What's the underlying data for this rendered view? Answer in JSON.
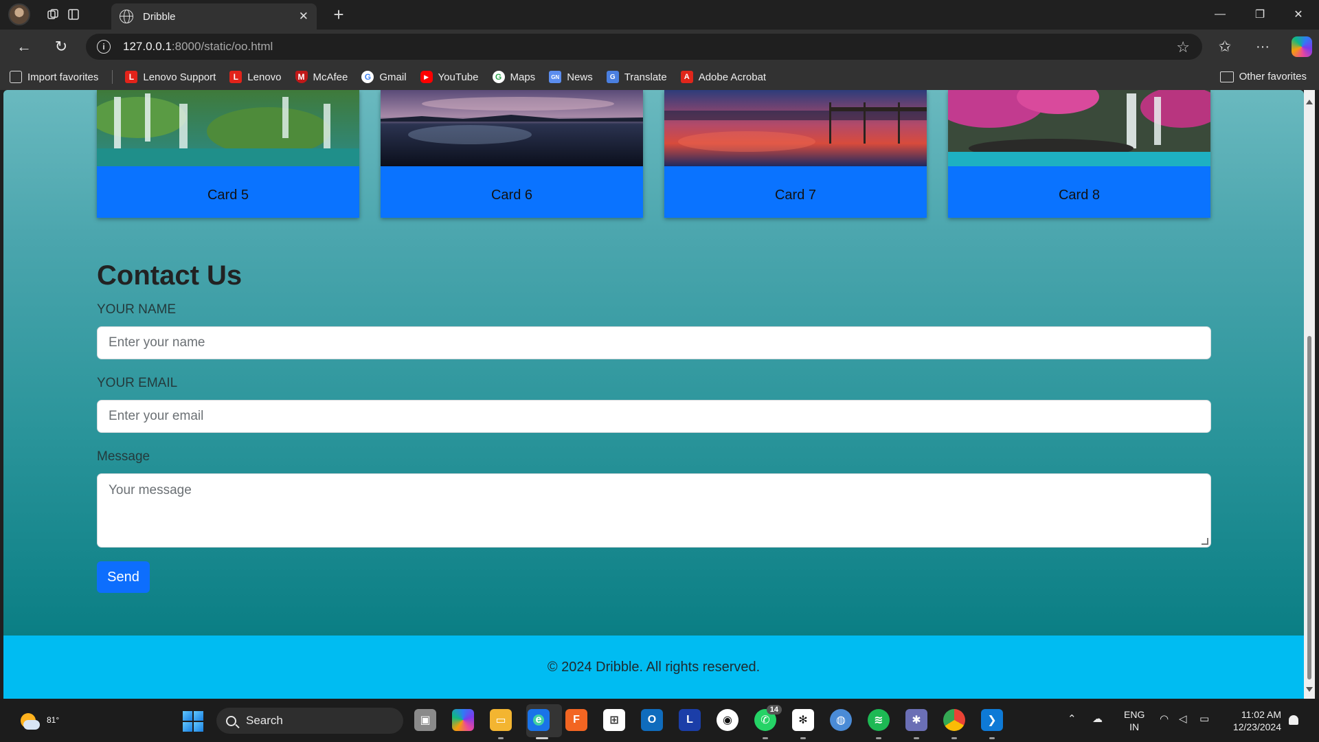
{
  "browser": {
    "tab_title": "Dribble",
    "url_host": "127.0.0.1",
    "url_path": ":8000/static/oo.html",
    "favorites": [
      {
        "label": "Import favorites",
        "icon": "import-icon",
        "color": "#cfcfcf"
      },
      {
        "label": "Lenovo Support",
        "icon": "lenovo-icon",
        "color": "#e2231a"
      },
      {
        "label": "Lenovo",
        "icon": "lenovo-icon",
        "color": "#e2231a"
      },
      {
        "label": "McAfee",
        "icon": "mcafee-icon",
        "color": "#c01818"
      },
      {
        "label": "Gmail",
        "icon": "google-icon",
        "color": "#4285f4"
      },
      {
        "label": "YouTube",
        "icon": "youtube-icon",
        "color": "#ff0000"
      },
      {
        "label": "Maps",
        "icon": "google-icon",
        "color": "#34a853"
      },
      {
        "label": "News",
        "icon": "news-icon",
        "color": "#5b8def"
      },
      {
        "label": "Translate",
        "icon": "translate-icon",
        "color": "#4a7fe0"
      },
      {
        "label": "Adobe Acrobat",
        "icon": "acrobat-icon",
        "color": "#e0261b"
      }
    ],
    "other_favorites": "Other favorites"
  },
  "page": {
    "cards": [
      {
        "title": "Card 5",
        "image": "waterfall-forest"
      },
      {
        "title": "Card 6",
        "image": "lake-night"
      },
      {
        "title": "Card 7",
        "image": "pier-sunset"
      },
      {
        "title": "Card 8",
        "image": "pink-trees-waterfall"
      }
    ],
    "contact": {
      "heading": "Contact Us",
      "name_label": "YOUR NAME",
      "name_placeholder": "Enter your name",
      "email_label": "YOUR EMAIL",
      "email_placeholder": "Enter your email",
      "message_label": "Message",
      "message_placeholder": "Your message",
      "send_label": "Send"
    },
    "footer": "© 2024 Dribble. All rights reserved.",
    "colors": {
      "card": "#0a73ff",
      "footer": "#00bcf2",
      "button": "#0d6efd"
    }
  },
  "taskbar": {
    "temperature": "81°",
    "search_label": "Search",
    "whatsapp_badge": "14",
    "lang_top": "ENG",
    "lang_bottom": "IN",
    "time": "11:02 AM",
    "date": "12/23/2024"
  }
}
